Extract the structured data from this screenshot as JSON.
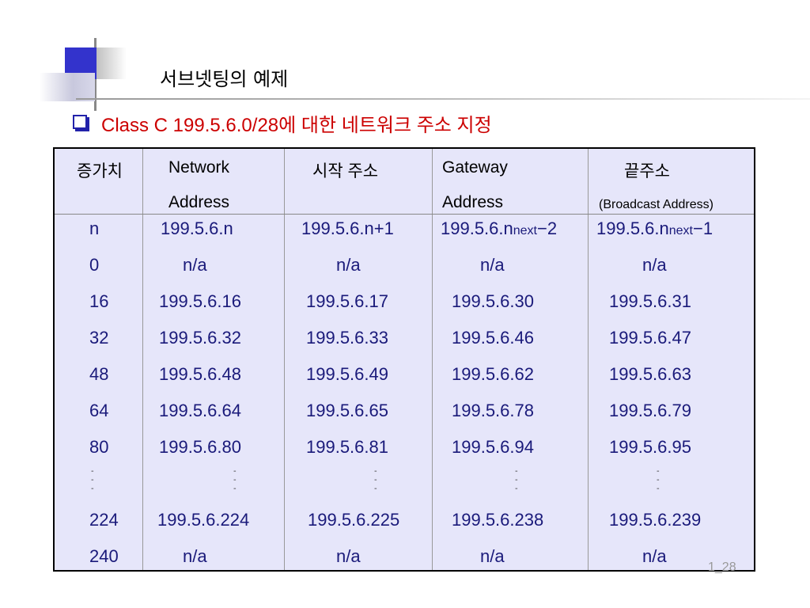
{
  "slide": {
    "title": "서브넷팅의 예제",
    "subtitle": "Class C 199.5.6.0/28에 대한 네트워크 주소 지정",
    "page_number": "1_28"
  },
  "table": {
    "headers": {
      "increment": "증가치",
      "network_l1": "Network",
      "network_l2": "Address",
      "start": "시작 주소",
      "gateway_l1": "Gateway",
      "gateway_l2": "Address",
      "end_l1": "끝주소",
      "end_l2": "(Broadcast Address)"
    },
    "formula_row": {
      "inc": "n",
      "network": "199.5.6.n",
      "start": "199.5.6.n+1",
      "gateway_base": "199.5.6.n",
      "gateway_sub": "next",
      "gateway_tail": "−2",
      "end_base": "199.5.6.n",
      "end_sub": "next",
      "end_tail": "−1"
    },
    "rows": [
      {
        "inc": "0",
        "network": "n/a",
        "start": "n/a",
        "gateway": "n/a",
        "end": "n/a"
      },
      {
        "inc": "16",
        "network": "199.5.6.16",
        "start": "199.5.6.17",
        "gateway": "199.5.6.30",
        "end": "199.5.6.31"
      },
      {
        "inc": "32",
        "network": "199.5.6.32",
        "start": "199.5.6.33",
        "gateway": "199.5.6.46",
        "end": "199.5.6.47"
      },
      {
        "inc": "48",
        "network": "199.5.6.48",
        "start": "199.5.6.49",
        "gateway": "199.5.6.62",
        "end": "199.5.6.63"
      },
      {
        "inc": "64",
        "network": "199.5.6.64",
        "start": "199.5.6.65",
        "gateway": "199.5.6.78",
        "end": "199.5.6.79"
      },
      {
        "inc": "80",
        "network": "199.5.6.80",
        "start": "199.5.6.81",
        "gateway": "199.5.6.94",
        "end": "199.5.6.95"
      },
      {
        "inc": "224",
        "network": "199.5.6.224",
        "start": "199.5.6.225",
        "gateway": "199.5.6.238",
        "end": "199.5.6.239"
      },
      {
        "inc": "240",
        "network": "n/a",
        "start": "n/a",
        "gateway": "n/a",
        "end": "n/a"
      }
    ],
    "ellipsis": "-\n-\n-"
  },
  "colors": {
    "accent": "#3333cc",
    "subtitle": "#cc0000",
    "table_bg": "#e6e6fa",
    "cell_text": "#1a1a7a"
  }
}
